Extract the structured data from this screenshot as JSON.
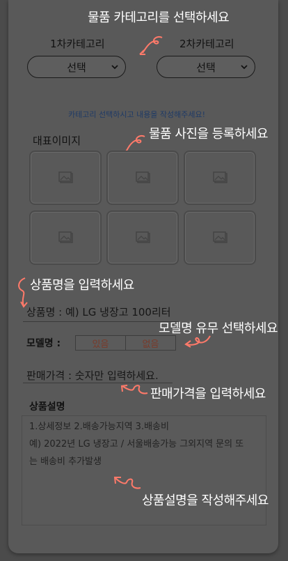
{
  "hints": {
    "category": "물품 카테고리를 선택하세요",
    "photo": "물품 사진을 등록하세요",
    "product_name": "상품명을 입력하세요",
    "model": "모델명 유무 선택하세요",
    "price": "판매가격을 입력하세요",
    "description": "상품설명을 작성해주세요"
  },
  "category": {
    "first_label": "1차카테고리",
    "second_label": "2차카테고리",
    "first_value": "선택",
    "second_value": "선택",
    "notice": "카테고리 선택하시고 내용을 작성해주세요!"
  },
  "images": {
    "title": "대표이미지",
    "slot_icon": "image-placeholder-icon"
  },
  "product_name": {
    "placeholder": "상품명 : 예) LG 냉장고 100리터"
  },
  "model": {
    "label": "모델명 :",
    "yes": "있음",
    "no": "없음"
  },
  "price": {
    "placeholder": "판매가격 : 숫자만 입력하세요."
  },
  "description": {
    "title": "상품설명",
    "placeholder_lines": [
      "1.상세정보 2.배송가능지역 3.배송비",
      "예) 2022년 LG 냉장고 / 서울배송가능 그외지역 문의 또",
      "는 배송비 추가발생"
    ]
  },
  "colors": {
    "hint_text": "#ffffff",
    "arrow": "#ff7a6a",
    "notice": "#1f3a66",
    "toggle_text": "#7a3a2a"
  }
}
